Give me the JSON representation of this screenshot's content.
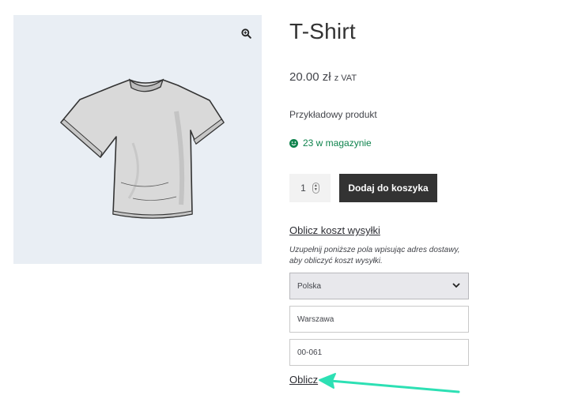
{
  "product": {
    "title": "T-Shirt",
    "price": "20.00 zł",
    "price_suffix": "z VAT",
    "description": "Przykładowy produkt",
    "stock": "23 w magazynie",
    "quantity": "1",
    "add_to_cart_label": "Dodaj do koszyka"
  },
  "shipping": {
    "title": "Oblicz koszt wysyłki",
    "hint_line1": "Uzupełnij poniższe pola wpisując adres dostawy,",
    "hint_line2": "aby obliczyć koszt wysyłki.",
    "country": "Polska",
    "city": "Warszawa",
    "postcode": "00-061",
    "submit_label": "Oblicz"
  },
  "icons": {
    "zoom": "zoom-icon",
    "stock": "smile-icon",
    "select": "chevron-down-icon",
    "annotation": "arrow-icon"
  },
  "colors": {
    "accent_dark": "#333333",
    "stock_green": "#0f834d",
    "annotation_arrow": "#2de0b4",
    "gallery_bg": "#e9eef4"
  }
}
